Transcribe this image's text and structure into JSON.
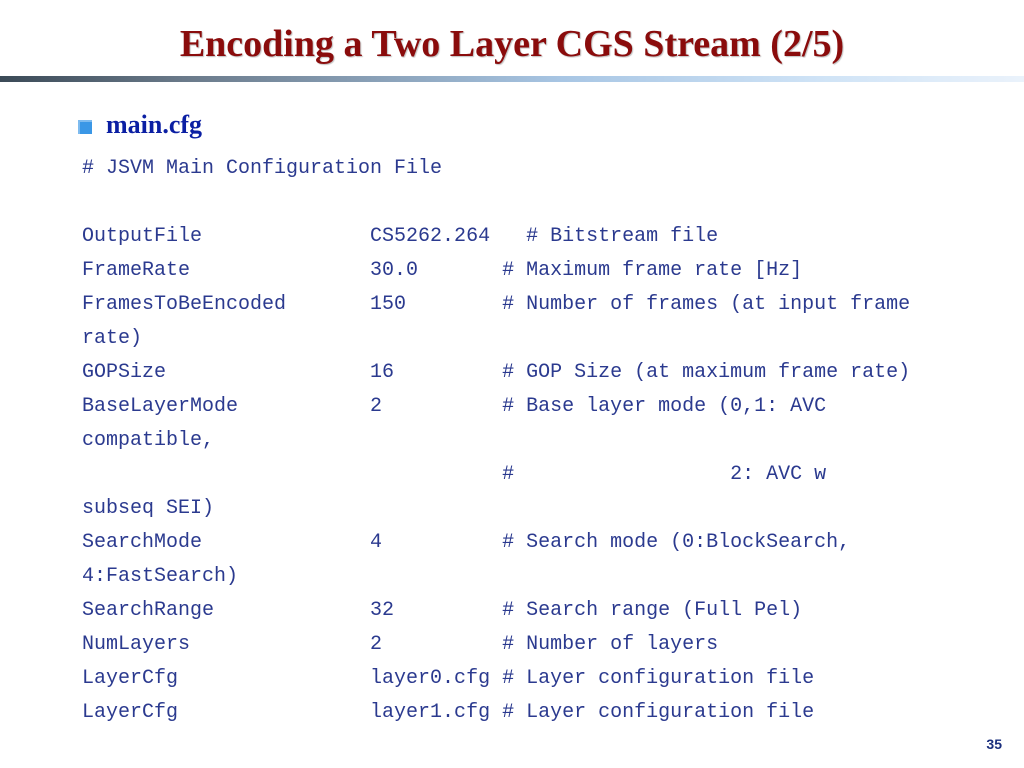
{
  "title": "Encoding a Two Layer CGS Stream (2/5)",
  "bullet": "main.cfg",
  "cfgText": "# JSVM Main Configuration File\n\nOutputFile              CS5262.264   # Bitstream file\nFrameRate               30.0       # Maximum frame rate [Hz]\nFramesToBeEncoded       150        # Number of frames (at input frame\nrate)\nGOPSize                 16         # GOP Size (at maximum frame rate)\nBaseLayerMode           2          # Base layer mode (0,1: AVC\ncompatible,\n                                   #                  2: AVC w\nsubseq SEI)\nSearchMode              4          # Search mode (0:BlockSearch,\n4:FastSearch)\nSearchRange             32         # Search range (Full Pel)\nNumLayers               2          # Number of layers\nLayerCfg                layer0.cfg # Layer configuration file\nLayerCfg                layer1.cfg # Layer configuration file",
  "pageNumber": "35"
}
